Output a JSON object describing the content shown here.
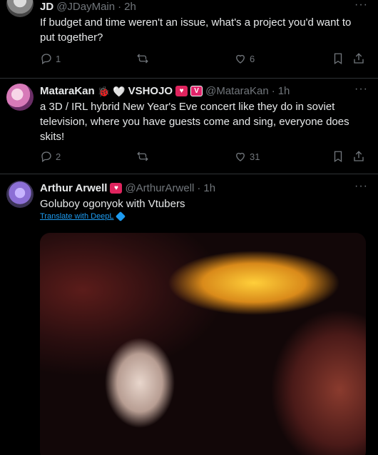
{
  "tweets": [
    {
      "display_name": "JD",
      "handle": "@JDayMain",
      "time": "2h",
      "text": "If budget and time weren't an issue, what's a project you'd want to put together?",
      "reply_count": "1",
      "like_count": "6"
    },
    {
      "display_name": "MataraKan",
      "emoji_1": "🐞",
      "emoji_2": "🤍",
      "org": "VSHOJO",
      "badge_v": "V",
      "handle": "@MataraKan",
      "time": "1h",
      "text": "a 3D / IRL hybrid New Year's Eve concert like they do in soviet television, where you have guests come and sing, everyone does skits!",
      "reply_count": "2",
      "like_count": "31"
    },
    {
      "display_name": "Arthur Arwell",
      "handle": "@ArthurArwell",
      "time": "1h",
      "text": "Goluboy ogonyok with Vtubers",
      "translate_label": "Translate with DeepL"
    }
  ],
  "separator": "·",
  "more_label": "···",
  "colors": {
    "accent": "#1d9bf0",
    "muted": "#71767b",
    "badge_red": "#e0245e"
  }
}
